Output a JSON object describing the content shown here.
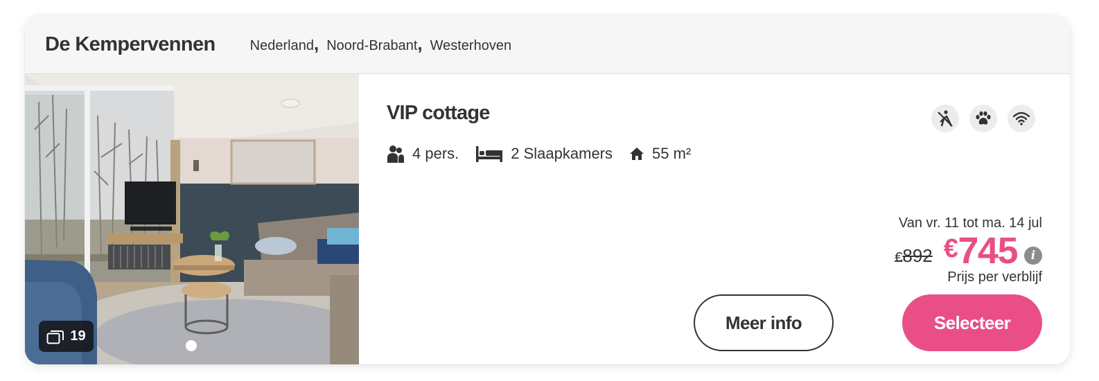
{
  "header": {
    "park_name": "De Kempervennen",
    "location": {
      "country": "Nederland",
      "province": "Noord-Brabant",
      "town": "Westerhoven",
      "separator": ","
    }
  },
  "photo": {
    "count": "19",
    "count_icon": "gallery-stack-icon",
    "slide_indicator": "dot"
  },
  "accommodation": {
    "title": "VIP cottage",
    "features": [
      {
        "icon": "persons-icon",
        "label": "4 pers."
      },
      {
        "icon": "bed-icon",
        "label": "2 Slaapkamers"
      },
      {
        "icon": "house-icon",
        "label": "55 m²"
      }
    ],
    "amenities": [
      "no-smoking-icon",
      "pets-allowed-icon",
      "wifi-icon"
    ]
  },
  "pricing": {
    "period": "Van vr. 11 tot ma. 14 jul",
    "currency": "€",
    "old_price": "892",
    "new_price": "745",
    "note": "Prijs per verblijf",
    "info_symbol": "i"
  },
  "actions": {
    "more_info_label": "Meer info",
    "select_label": "Selecteer"
  },
  "colors": {
    "accent_pink": "#e94f86",
    "header_bg": "#f6f6f6",
    "text_dark": "#333333"
  }
}
